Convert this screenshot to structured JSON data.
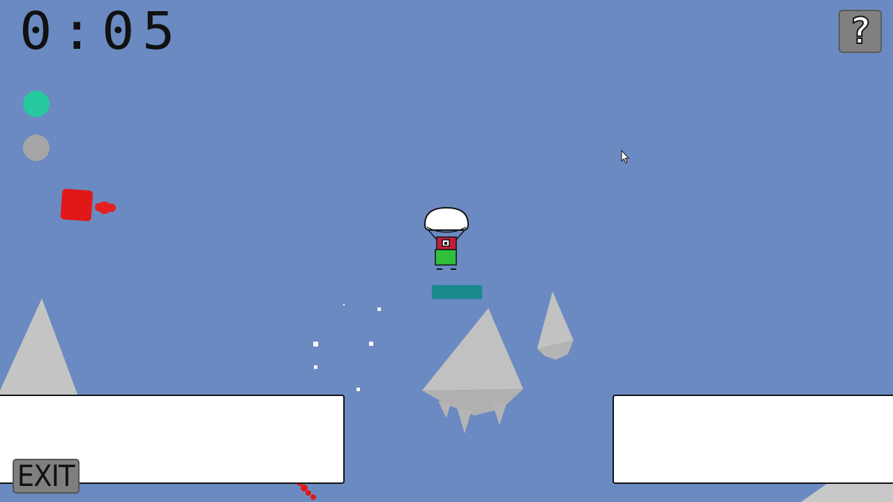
{
  "hud": {
    "timer": [
      "0",
      ":",
      "0",
      "5"
    ],
    "help_label": "?",
    "exit_label": "EXIT",
    "indicators": [
      {
        "name": "active",
        "color": "#26c8a0"
      },
      {
        "name": "inactive",
        "color": "#a6a6a6"
      }
    ]
  },
  "colors": {
    "sky": "#6a8ac1",
    "rock": "#c4c4c4",
    "enemy": "#e01818",
    "landing_pad": "#1a8a8e",
    "platform": "#ffffff"
  },
  "icons": [
    "question-mark-icon",
    "mouse-cursor-icon",
    "parachute-icon"
  ]
}
